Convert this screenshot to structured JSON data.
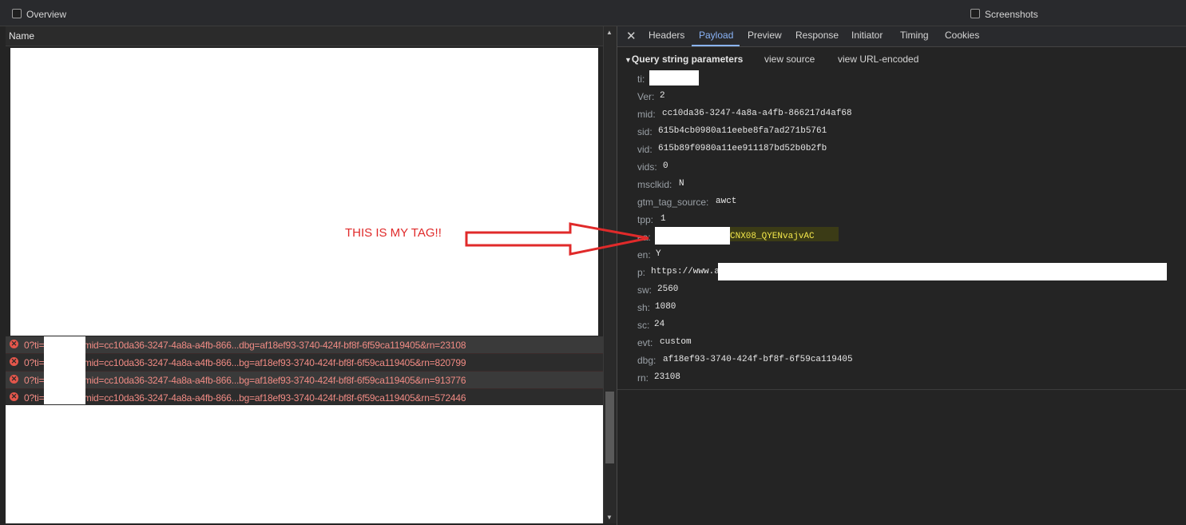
{
  "topbar": {
    "overview_label": "Overview",
    "screenshots_label": "Screenshots"
  },
  "left_pane": {
    "column_header": "Name",
    "requests": [
      {
        "text": "0?ti=            &Ver=2&mid=cc10da36-3247-4a8a-a4fb-866...dbg=af18ef93-3740-424f-bf8f-6f59ca119405&rn=23108"
      },
      {
        "text": "0?ti=            &Ver=2&mid=cc10da36-3247-4a8a-a4fb-866...bg=af18ef93-3740-424f-bf8f-6f59ca119405&rn=820799"
      },
      {
        "text": "0?ti=            &Ver=2&mid=cc10da36-3247-4a8a-a4fb-866...bg=af18ef93-3740-424f-bf8f-6f59ca119405&rn=913776"
      },
      {
        "text": "0?ti=            &Ver=2&mid=cc10da36-3247-4a8a-a4fb-866...bg=af18ef93-3740-424f-bf8f-6f59ca119405&rn=572446"
      }
    ]
  },
  "tabs": [
    "Headers",
    "Payload",
    "Preview",
    "Response",
    "Initiator",
    "Timing",
    "Cookies"
  ],
  "active_tab": "Payload",
  "payload": {
    "section_title": "Query string parameters",
    "view_source": "view source",
    "view_url_encoded": "view URL-encoded",
    "params": [
      {
        "key": "ti:",
        "value": ""
      },
      {
        "key": "Ver:",
        "value": "2"
      },
      {
        "key": "mid:",
        "value": "cc10da36-3247-4a8a-a4fb-866217d4af68"
      },
      {
        "key": "sid:",
        "value": "615b4cb0980a11eebe8fa7ad271b5761"
      },
      {
        "key": "vid:",
        "value": "615b89f0980a11ee911187bd52b0b2fb"
      },
      {
        "key": "vids:",
        "value": "0"
      },
      {
        "key": "msclkid:",
        "value": "N"
      },
      {
        "key": "gtm_tag_source:",
        "value": "awct"
      },
      {
        "key": "tpp:",
        "value": "1"
      },
      {
        "key": "ea:",
        "value": "CNX08_QYENvajvAC"
      },
      {
        "key": "en:",
        "value": "Y"
      },
      {
        "key": "p:",
        "value": "https://www.a"
      },
      {
        "key": "sw:",
        "value": "2560"
      },
      {
        "key": "sh:",
        "value": "1080"
      },
      {
        "key": "sc:",
        "value": "24"
      },
      {
        "key": "evt:",
        "value": "custom"
      },
      {
        "key": "dbg:",
        "value": "af18ef93-3740-424f-bf8f-6f59ca119405"
      },
      {
        "key": "rn:",
        "value": "23108"
      }
    ]
  },
  "annotation": {
    "text": "THIS IS MY TAG!!"
  },
  "colors": {
    "accent": "#8ab4f8",
    "error": "#e3564b",
    "annotation": "#e02a2a",
    "highlight": "#f2e64a"
  }
}
